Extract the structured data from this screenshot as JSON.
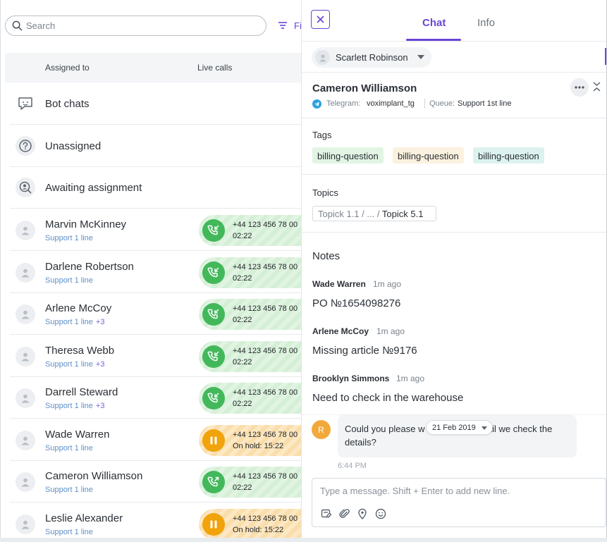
{
  "search": {
    "placeholder": "Search",
    "filter_label": "Fi"
  },
  "list_header": {
    "assigned_to": "Assigned to",
    "live_calls": "Live calls"
  },
  "groups": [
    {
      "label": "Bot chats",
      "icon": "bot-chat-icon"
    },
    {
      "label": "Unassigned",
      "icon": "question-circle-icon"
    },
    {
      "label": "Awaiting assignment",
      "icon": "search-user-icon"
    }
  ],
  "operators": [
    {
      "name": "Marvin McKinney",
      "queue": "Support 1 line",
      "extra": "",
      "phone": "+44 123 456 78 00",
      "status": "02:22",
      "call_state": "active"
    },
    {
      "name": "Darlene Robertson",
      "queue": "Support 1 line",
      "extra": "",
      "phone": "+44 123 456 78 00",
      "status": "02:22",
      "call_state": "active"
    },
    {
      "name": "Arlene McCoy",
      "queue": "Support 1 line",
      "extra": "+3",
      "phone": "+44 123 456 78 00",
      "status": "02:22",
      "call_state": "active"
    },
    {
      "name": "Theresa Webb",
      "queue": "Support 1 line",
      "extra": "+3",
      "phone": "+44 123 456 78 00",
      "status": "02:22",
      "call_state": "active"
    },
    {
      "name": "Darrell Steward",
      "queue": "Support 1 line",
      "extra": "+3",
      "phone": "+44 123 456 78 00",
      "status": "02:22",
      "call_state": "active"
    },
    {
      "name": "Wade Warren",
      "queue": "Support 1 line",
      "extra": "",
      "phone": "+44 123 456 78 00",
      "status": "On hold: 15:22",
      "call_state": "hold"
    },
    {
      "name": "Cameron Williamson",
      "queue": "Support 1 line",
      "extra": "",
      "phone": "+44 123 456 78 00",
      "status": "02:22",
      "call_state": "active"
    },
    {
      "name": "Leslie Alexander",
      "queue": "Support 1 line",
      "extra": "",
      "phone": "+44 123 456 78 00",
      "status": "On hold: 15:22",
      "call_state": "hold"
    }
  ],
  "panel": {
    "tabs": {
      "chat": "Chat",
      "info": "Info"
    },
    "assignee": "Scarlett Robinson",
    "contact": {
      "name": "Cameron Williamson",
      "channel_label": "Telegram:",
      "channel_value": "voximplant_tg",
      "queue_label": "Queue:",
      "queue_value": "Support 1st line"
    },
    "tags_title": "Tags",
    "tags": [
      {
        "label": "billing-question",
        "color": "#e2f5e4"
      },
      {
        "label": "billing-question",
        "color": "#fbf1df"
      },
      {
        "label": "billing-question",
        "color": "#dcf2ef"
      }
    ],
    "topics_title": "Topics",
    "topic": {
      "part1": "Topick 1.1",
      "sep1": "/",
      "ellipsis": "...",
      "sep2": "/",
      "part2": "Topick 5.1"
    },
    "notes_title": "Notes",
    "notes": [
      {
        "author": "Wade Warren",
        "time": "1m ago",
        "text": "PO №1654098276"
      },
      {
        "author": "Arlene McCoy",
        "time": "1m ago",
        "text": "Missing article №9176"
      },
      {
        "author": "Brooklyn Simmons",
        "time": "1m ago",
        "text": "Need to check in the warehouse"
      }
    ],
    "message": {
      "avatar_letter": "R",
      "text_before": "Could you please w",
      "text_after": "til we check the",
      "text_line2": "details?",
      "date_chip": "21 Feb 2019",
      "time": "6:44 PM"
    },
    "composer_placeholder": "Type a message. Shift + Enter to add new line."
  },
  "colors": {
    "accent": "#6a45d6",
    "call_active": "#43b85b",
    "call_hold": "#f0a30a"
  }
}
